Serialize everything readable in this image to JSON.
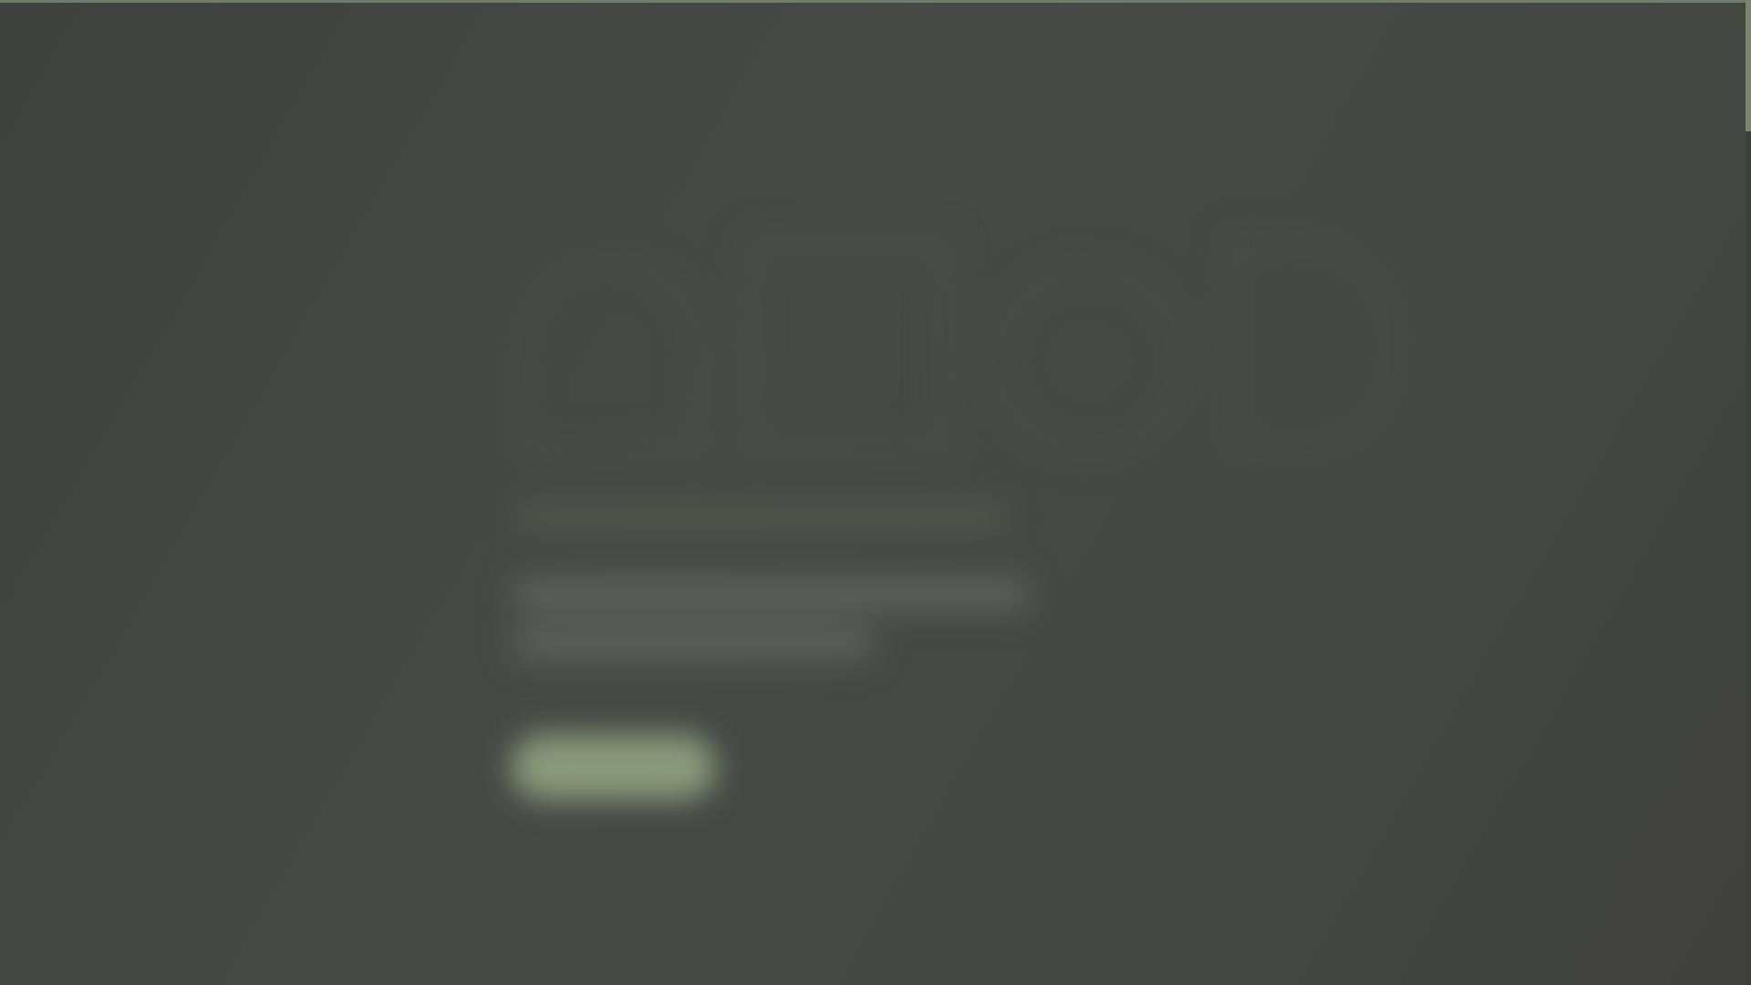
{
  "page": {
    "title": "",
    "is_blurred": true
  },
  "colors": {
    "background": "#434641",
    "overlay_dark": "#3f423e",
    "accent": "#8a9a7b",
    "text_placeholder": "#5a5d58",
    "scrollbar_thumb": "#879378"
  },
  "hero": {
    "title": "",
    "body": "",
    "cta_label": ""
  },
  "scrollbar": {
    "position_fraction": 0.0
  }
}
